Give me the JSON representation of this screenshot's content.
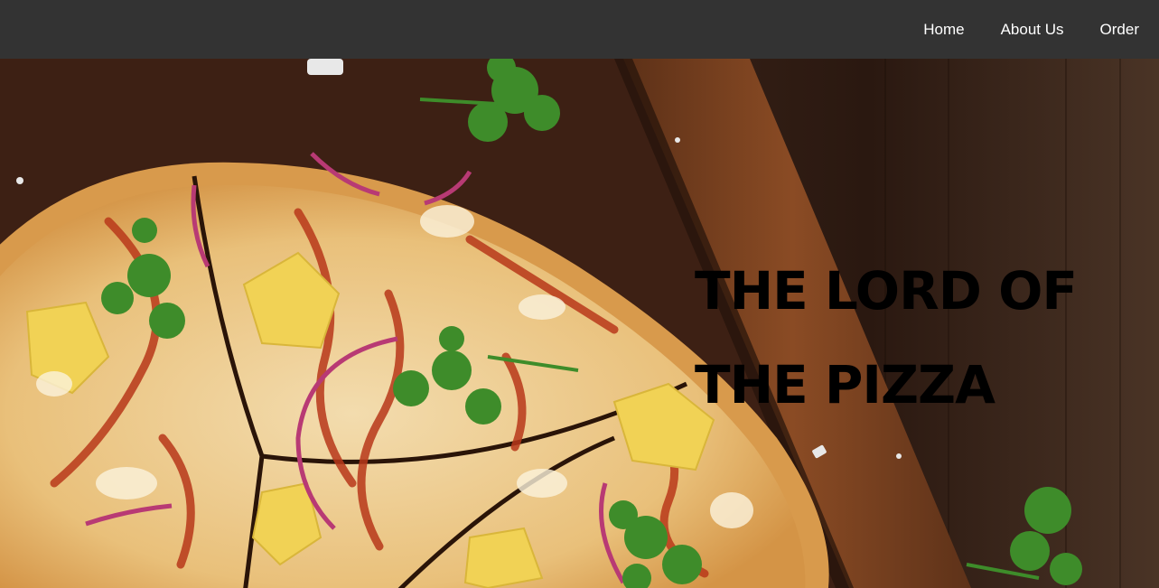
{
  "nav": {
    "links": [
      {
        "label": "Home"
      },
      {
        "label": "About Us"
      },
      {
        "label": "Order"
      }
    ]
  },
  "hero": {
    "headline_line1": "THE LORD OF",
    "headline_line2": "THE PIZZA",
    "image": "pizza-on-wooden-board-photo"
  },
  "colors": {
    "navbar": "#333333",
    "nav_text": "#ffffff",
    "headline": "#000000",
    "wood_dark": "#3a2418",
    "board": "#7a4423",
    "crust": "#e9b56a",
    "cheese": "#f3e3c3",
    "sauce": "#b8381a",
    "cilantro": "#3e8c2a",
    "onion": "#b83a74"
  }
}
